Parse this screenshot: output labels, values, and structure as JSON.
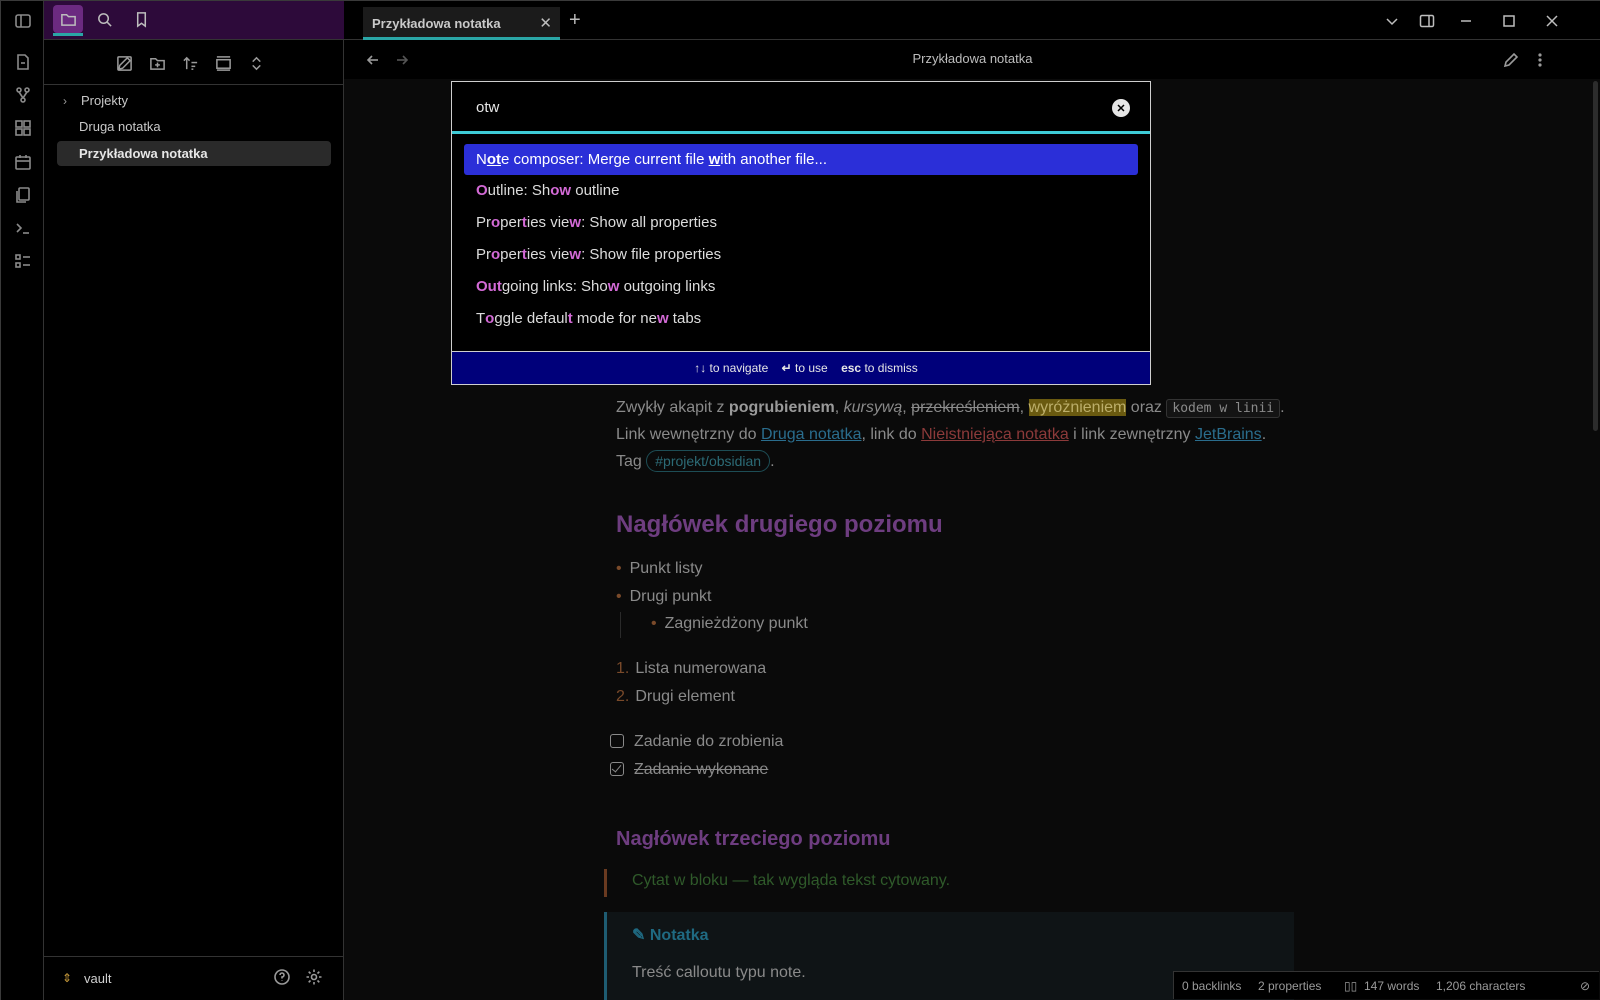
{
  "tabbar": {
    "active_tab": "Przykładowa notatka"
  },
  "view_header": {
    "title": "Przykładowa notatka"
  },
  "sidebar": {
    "tree": [
      {
        "label": "Projekty",
        "type": "folder"
      },
      {
        "label": "Druga notatka",
        "type": "file"
      },
      {
        "label": "Przykładowa notatka",
        "type": "file",
        "active": true
      }
    ],
    "vault_name": "vault"
  },
  "palette": {
    "query": "otw",
    "suggestions": [
      {
        "parts": [
          [
            "N",
            0
          ],
          [
            "o",
            1
          ],
          [
            "t",
            1
          ],
          [
            "e composer: Merge current file ",
            0
          ],
          [
            "w",
            1
          ],
          [
            "ith another file...",
            0
          ]
        ]
      },
      {
        "parts": [
          [
            "O",
            1
          ],
          [
            "utline: Sh",
            0
          ],
          [
            "o",
            1
          ],
          [
            "w",
            1
          ],
          [
            " outline",
            0
          ]
        ]
      },
      {
        "parts": [
          [
            "Pr",
            0
          ],
          [
            "o",
            1
          ],
          [
            "per",
            0
          ],
          [
            "t",
            1
          ],
          [
            "ies vie",
            0
          ],
          [
            "w",
            1
          ],
          [
            ": Show all properties",
            0
          ]
        ]
      },
      {
        "parts": [
          [
            "Pr",
            0
          ],
          [
            "o",
            1
          ],
          [
            "per",
            0
          ],
          [
            "t",
            1
          ],
          [
            "ies vie",
            0
          ],
          [
            "w",
            1
          ],
          [
            ": Show file properties",
            0
          ]
        ]
      },
      {
        "parts": [
          [
            "O",
            1
          ],
          [
            "ut",
            1
          ],
          [
            "going links: Sho",
            0
          ],
          [
            "w",
            1
          ],
          [
            " outgoing links",
            0
          ]
        ]
      },
      {
        "parts": [
          [
            "T",
            0
          ],
          [
            "o",
            1
          ],
          [
            "ggle defaul",
            0
          ],
          [
            "t",
            1
          ],
          [
            " mode for ne",
            0
          ],
          [
            "w",
            1
          ],
          [
            " tabs",
            0
          ]
        ]
      }
    ],
    "footer": {
      "nav_keys": "↑↓",
      "nav_label": "to navigate",
      "use_key": "↵",
      "use_label": "to use",
      "esc_key": "esc",
      "esc_label": "to dismiss"
    }
  },
  "editor": {
    "para1": {
      "t1": "Zwykły akapit z ",
      "bold": "pogrubieniem",
      "t2": ", ",
      "italic": "kursywą",
      "t3": ", ",
      "strike": "przekreśleniem",
      "t4": ", ",
      "highlight": "wyróżnieniem",
      "t5": " oraz ",
      "code": "kodem w linii",
      "t6": ". Link wewnętrzny do ",
      "link1": "Druga notatka",
      "t7": ", link do ",
      "link2": "Nieistniejąca notatka",
      "t8": " i link zewnętrzny ",
      "link3": "JetBrains",
      "t9": ". Tag ",
      "tag": "#projekt/obsidian",
      "t10": "."
    },
    "h2": "Nagłówek drugiego poziomu",
    "bullets": [
      "Punkt listy",
      "Drugi punkt"
    ],
    "nested_bullet": "Zagnieżdżony punkt",
    "numbered": [
      "Lista numerowana",
      "Drugi element"
    ],
    "numbers": [
      "1.",
      "2."
    ],
    "tasks": [
      {
        "label": "Zadanie do zrobienia",
        "done": false
      },
      {
        "label": "Zadanie wykonane",
        "done": true
      }
    ],
    "h3": "Nagłówek trzeciego poziomu",
    "quote": "Cytat w bloku — tak wygląda tekst cytowany.",
    "callout_title": "Notatka",
    "callout_body": "Treść calloutu typu note."
  },
  "statusbar": {
    "backlinks": "0 backlinks",
    "properties": "2 properties",
    "words": "147 words",
    "characters": "1,206 characters"
  },
  "colors": {
    "accent": "#2aa6a6",
    "selection": "#2b2fd8",
    "footer": "#00007a",
    "match": "#d36ad6"
  }
}
